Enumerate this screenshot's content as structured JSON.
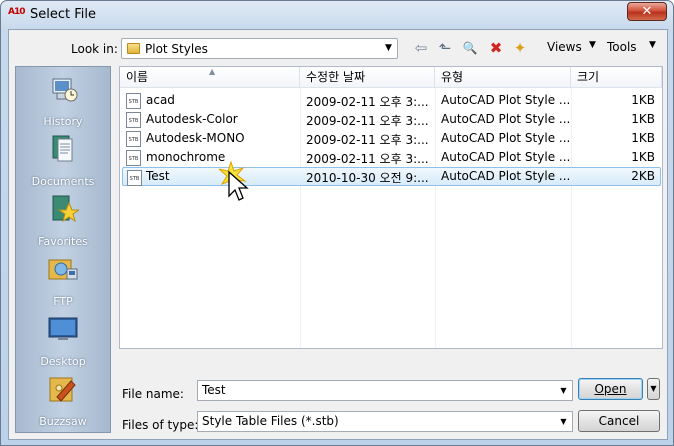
{
  "window": {
    "title": "Select File",
    "app_icon_text": "A10",
    "close_symbol": "✕"
  },
  "lookin": {
    "label": "Look in:",
    "value": "Plot Styles"
  },
  "toolbar": {
    "back_symbol": "⇦",
    "up_symbol": "⬑",
    "search_symbol": "🔍",
    "delete_symbol": "✖",
    "newfolder_symbol": "✦",
    "views_label": "Views",
    "tools_label": "Tools",
    "drop_symbol": "▼"
  },
  "places": [
    {
      "label": "History",
      "icon": "history-icon"
    },
    {
      "label": "Documents",
      "icon": "documents-icon"
    },
    {
      "label": "Favorites",
      "icon": "favorites-icon"
    },
    {
      "label": "FTP",
      "icon": "ftp-icon"
    },
    {
      "label": "Desktop",
      "icon": "desktop-icon"
    },
    {
      "label": "Buzzsaw",
      "icon": "buzzsaw-icon"
    }
  ],
  "filelist": {
    "columns": [
      "이름",
      "수정한 날짜",
      "유형",
      "크기"
    ],
    "icon_text": "STB",
    "rows": [
      {
        "name": "acad",
        "date": "2009-02-11 오후 3:...",
        "type": "AutoCAD Plot Style ...",
        "size": "1KB"
      },
      {
        "name": "Autodesk-Color",
        "date": "2009-02-11 오후 3:...",
        "type": "AutoCAD Plot Style ...",
        "size": "1KB"
      },
      {
        "name": "Autodesk-MONO",
        "date": "2009-02-11 오후 3:...",
        "type": "AutoCAD Plot Style ...",
        "size": "1KB"
      },
      {
        "name": "monochrome",
        "date": "2009-02-11 오후 3:...",
        "type": "AutoCAD Plot Style ...",
        "size": "1KB"
      },
      {
        "name": "Test",
        "date": "2010-10-30 오전 9:...",
        "type": "AutoCAD Plot Style ...",
        "size": "2KB",
        "selected": true
      }
    ]
  },
  "filename": {
    "label": "File name:",
    "value": "Test"
  },
  "filetype": {
    "label": "Files of type:",
    "value": "Style Table Files (*.stb)"
  },
  "buttons": {
    "open": "Open",
    "cancel": "Cancel"
  },
  "colors": {
    "selection_bg": "#d6ebfa",
    "selection_border": "#8ec1ea",
    "places_bg": "#b3c5da"
  }
}
